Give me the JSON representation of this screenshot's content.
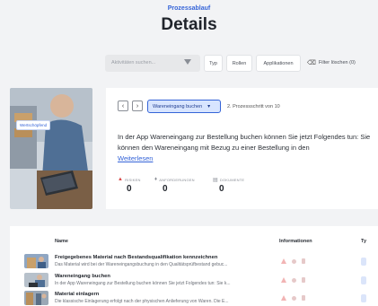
{
  "header": {
    "eyebrow": "Prozessablauf",
    "title": "Details"
  },
  "filters": {
    "search_placeholder": "Aktivitäten suchen...",
    "chips": [
      "Typ",
      "Rollen",
      "Applikationen"
    ],
    "clear_label": "Filter löschen (0)"
  },
  "hero": {
    "badge": "Wertschöpfend"
  },
  "detail": {
    "dropdown_value": "Wareneingang buchen",
    "step_text": "2. Prozessschritt von 10",
    "description": "In der App Wareneingang zur Bestellung buchen können Sie jetzt Folgendes tun: Sie können den Wareneingang mit Bezug zu einer Bestellung in den",
    "more_link": "Weiterlesen",
    "stats": [
      {
        "label": "RISIKEN",
        "value": "0",
        "icon": "warning-icon",
        "color": "#d94848"
      },
      {
        "label": "ANFORDERUNGEN",
        "value": "0",
        "icon": "pin-icon",
        "color": "#8a8e96"
      },
      {
        "label": "DOKUMENTE",
        "value": "0",
        "icon": "document-icon",
        "color": "#8a8e96"
      }
    ]
  },
  "table": {
    "columns": [
      "Name",
      "Informationen",
      "Ty"
    ],
    "rows": [
      {
        "title": "Freigegebenes Material nach Bestandsqualifikation kennzeichnen",
        "subtitle": "Das Material wird bei der Wareneingangsbuchung in den Qualitätsprüfbestand gebuc..."
      },
      {
        "title": "Wareneingang buchen",
        "subtitle": "In der App Wareneingang zur Bestellung buchen können Sie jetzt Folgendes tun: Sie k..."
      },
      {
        "title": "Material einlagern",
        "subtitle": "Die klassische Einlagerung erfolgt nach der physischen Anlieferung von Waren. Die E..."
      }
    ]
  },
  "colors": {
    "accent": "#3564d8",
    "risk": "#d94848",
    "page_bg": "#f2f3f5"
  }
}
